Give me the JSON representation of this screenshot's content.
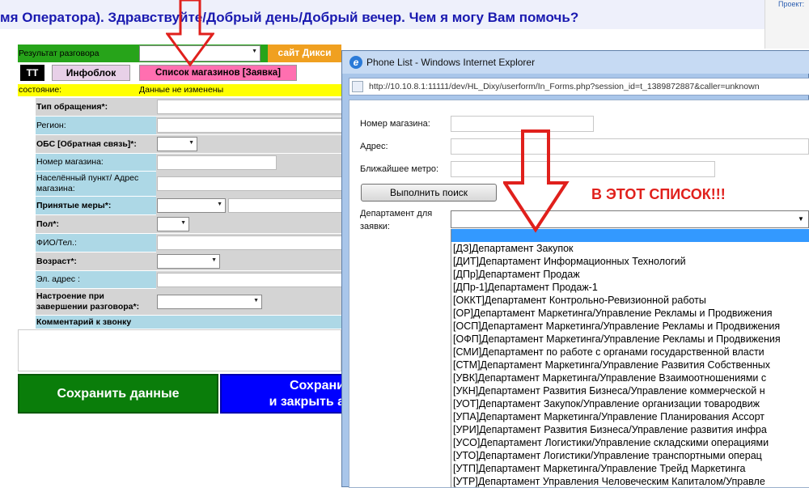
{
  "greeting": "мя Оператора). Здравствуйте/Добрый день/Добрый вечер. Чем я могу Вам помочь?",
  "project_label": "Проект:",
  "form": {
    "result_label": "Результат разговора",
    "dixy_site_btn": "сайт Дикси",
    "tab_tt": "ТТ",
    "tab_infoblock": "Инфоблок",
    "tab_stores": "Список магазинов [Заявка]",
    "state_label": "состояние:",
    "state_value": "Данные не изменены",
    "fields": [
      {
        "label": "Тип обращения*:"
      },
      {
        "label": "Регион:"
      },
      {
        "label": "ОБС [Обратная связь]*:"
      },
      {
        "label": "Номер магазина:"
      },
      {
        "label": "Населённый пункт/ Адрес магазина:"
      },
      {
        "label": "Принятые меры*:"
      },
      {
        "label": "Пол*:"
      },
      {
        "label": "ФИО/Тел.:"
      },
      {
        "label": "Возраст*:"
      },
      {
        "label": "Эл. адрес :"
      },
      {
        "label": "Настроение при завершении разговора*:"
      }
    ],
    "comment_label": "Комментарий к звонку",
    "save_btn": "Сохранить данные",
    "save_close_btn_line1": "Сохрани",
    "save_close_btn_line2": "и закрыть а"
  },
  "dialog": {
    "title": "Phone List - Windows Internet Explorer",
    "url": "http://10.10.8.1:11111/dev/HL_Dixy/userform/In_Forms.php?session_id=t_1389872887&caller=unknown",
    "store_no_label": "Номер магазина:",
    "address_label": "Адрес:",
    "metro_label": "Ближайшее метро:",
    "search_btn": "Выполнить поиск",
    "dept_label": "Департамент для заявки:",
    "annotation": "В ЭТОТ СПИСОК!!!",
    "departments": [
      "[ДЗ]Департамент Закупок",
      "[ДИТ]Департамент Информационных Технологий",
      "[ДПр]Департамент Продаж",
      "[ДПр-1]Департамент Продаж-1",
      "[ОККТ]Департамент Контрольно-Ревизионной работы",
      "[ОР]Департамент Маркетинга/Управление Рекламы и Продвижения",
      "[ОСП]Департамент Маркетинга/Управление Рекламы и Продвижения",
      "[ОФП]Департамент Маркетинга/Управление Рекламы и Продвижения",
      "[СМИ]Департамент по работе с органами государственной власти",
      "[СТМ]Департамент Маркетинга/Управление Развития Собственных",
      "[УВК]Департамент Маркетинга/Управление Взаимоотношениями с",
      "[УКН]Департамент Развития Бизнеса/Управление коммерческой н",
      "[УОТ]Департамент Закупок/Управление организации товародвиж",
      "[УПА]Департамент Маркетинга/Управление Планирования Ассорт",
      "[УРИ]Департамент Развития Бизнеса/Управление развития инфра",
      "[УСО]Департамент Логистики/Управление складскими операциями",
      "[УТО]Департамент Логистики/Управление транспортными операц",
      "[УТП]Департамент Маркетинга/Управление Трейд Маркетинга",
      "[УТР]Департамент Управления Человеческим Капиталом/Управле"
    ]
  },
  "colors": {
    "green": "#27a41a",
    "orange": "#f0a020",
    "pink": "#ff6fb0",
    "yellow": "#ffff00",
    "lightblue": "#add8e6",
    "arrow_red": "#e0201c",
    "annotation_red": "#e0201c"
  }
}
